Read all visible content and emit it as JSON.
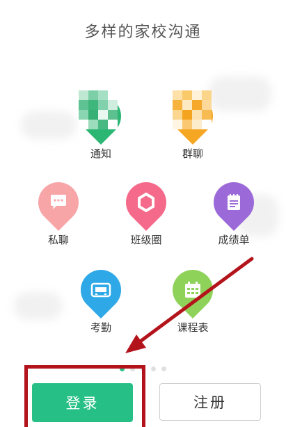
{
  "header": {
    "title": "多样的家校沟通"
  },
  "features": [
    {
      "id": "notice",
      "label": "通知",
      "icon": "megaphone-icon",
      "color": "#2bb673"
    },
    {
      "id": "group",
      "label": "群聊",
      "icon": "group-chat-icon",
      "color": "#f5a623"
    },
    {
      "id": "private",
      "label": "私聊",
      "icon": "chat-bubble-icon",
      "color": "#f8a5a8"
    },
    {
      "id": "circle",
      "label": "班级圈",
      "icon": "hexagon-ring-icon",
      "color": "#f56a8a"
    },
    {
      "id": "report",
      "label": "成绩单",
      "icon": "notepad-icon",
      "color": "#9b6ad8"
    },
    {
      "id": "attendance",
      "label": "考勤",
      "icon": "clock-display-icon",
      "color": "#2ea8e6"
    },
    {
      "id": "schedule",
      "label": "课程表",
      "icon": "calendar-icon",
      "color": "#8fd25a"
    }
  ],
  "pager": {
    "count": 5,
    "active_index": 0
  },
  "actions": {
    "login_label": "登录",
    "register_label": "注册"
  },
  "colors": {
    "accent": "#26c086",
    "annotation_red": "#b3141c"
  }
}
